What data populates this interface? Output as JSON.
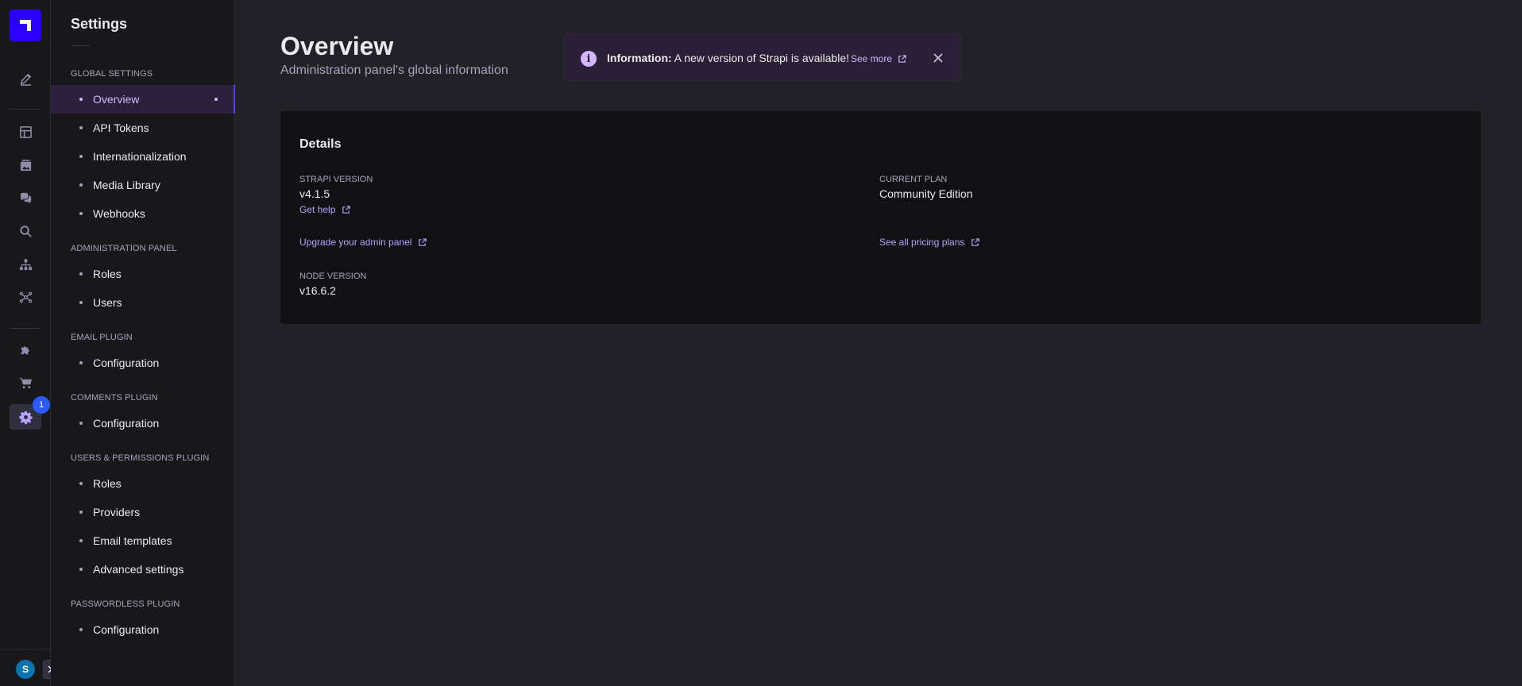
{
  "rail": {
    "badge_count": "1",
    "avatar_initial": "S",
    "icons": [
      "content-manager-icon",
      "content-type-builder-icon",
      "media-library-icon",
      "comments-icon",
      "search-icon",
      "sitemap-icon",
      "graph-icon",
      "plugins-icon",
      "marketplace-icon",
      "settings-icon"
    ]
  },
  "subnav": {
    "title": "Settings",
    "sections": [
      {
        "label": "GLOBAL SETTINGS",
        "items": [
          "Overview",
          "API Tokens",
          "Internationalization",
          "Media Library",
          "Webhooks"
        ]
      },
      {
        "label": "ADMINISTRATION PANEL",
        "items": [
          "Roles",
          "Users"
        ]
      },
      {
        "label": "EMAIL PLUGIN",
        "items": [
          "Configuration"
        ]
      },
      {
        "label": "COMMENTS PLUGIN",
        "items": [
          "Configuration"
        ]
      },
      {
        "label": "USERS & PERMISSIONS PLUGIN",
        "items": [
          "Roles",
          "Providers",
          "Email templates",
          "Advanced settings"
        ]
      },
      {
        "label": "PASSWORDLESS PLUGIN",
        "items": [
          "Configuration"
        ]
      }
    ],
    "active_item": "Overview"
  },
  "header": {
    "title": "Overview",
    "subtitle": "Administration panel's global information"
  },
  "alert": {
    "title": "Information:",
    "message": "A new version of Strapi is available!",
    "link": "See more"
  },
  "details": {
    "title": "Details",
    "strapi_version_label": "STRAPI VERSION",
    "strapi_version": "v4.1.5",
    "get_help": "Get help",
    "current_plan_label": "CURRENT PLAN",
    "current_plan": "Community Edition",
    "upgrade_link": "Upgrade your admin panel",
    "pricing_link": "See all pricing plans",
    "node_version_label": "NODE VERSION",
    "node_version": "v16.6.2"
  },
  "colors": {
    "accent": "#4945ff",
    "active_text": "#d0bcff",
    "link": "#b3a3ff",
    "background": "#212127"
  }
}
